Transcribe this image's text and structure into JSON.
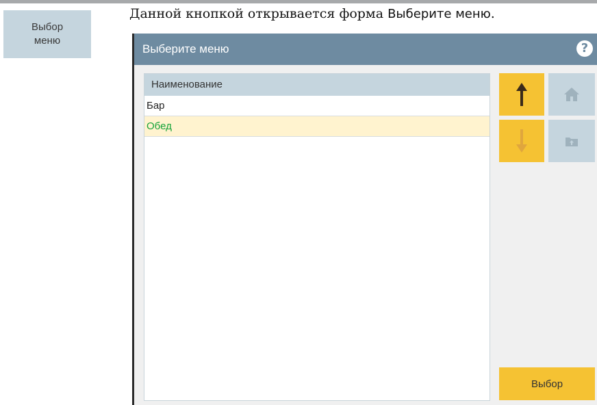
{
  "side_button": {
    "label": "Выбор\nменю"
  },
  "caption": {
    "text": "Данной кнопкой открывается форма ",
    "form_ref": "Выберите меню",
    "end": "."
  },
  "dialog": {
    "title": "Выберите меню",
    "help_glyph": "?",
    "list": {
      "column_header": "Наименование",
      "rows": [
        {
          "name": "Бар",
          "selected": false
        },
        {
          "name": "Обед",
          "selected": true
        }
      ]
    },
    "select_label": "Выбор"
  },
  "icons": {
    "up": "arrow-up-icon",
    "down": "arrow-down-icon",
    "home": "home-icon",
    "folder_up": "folder-up-icon",
    "help": "help-icon"
  },
  "colors": {
    "titlebar": "#6e8ba1",
    "accent_yellow": "#f5c233",
    "light_blue": "#c5d5de",
    "selected_row_bg": "#fff3cf",
    "selected_row_text": "#17a33a"
  }
}
